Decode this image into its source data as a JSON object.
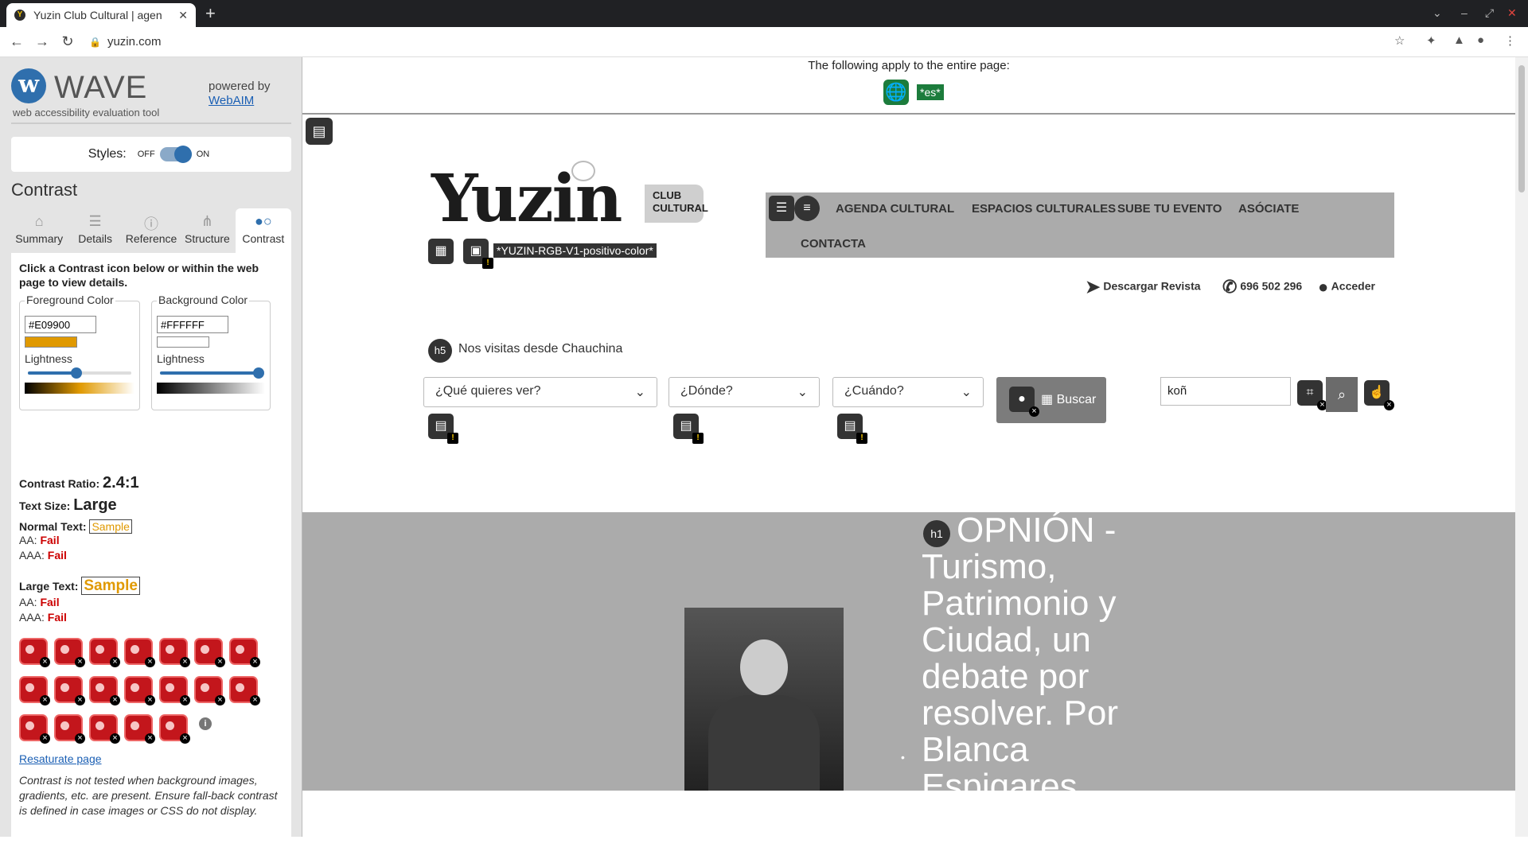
{
  "browser": {
    "tab_title": "Yuzin Club Cultural | agen",
    "url": "yuzin.com",
    "new_tab": "+"
  },
  "wave": {
    "title": "WAVE",
    "subtitle": "web accessibility evaluation tool",
    "powered_by": "powered by",
    "webaim": "WebAIM",
    "styles_label": "Styles:",
    "off": "OFF",
    "on": "ON",
    "section_title": "Contrast",
    "tabs": [
      {
        "label": "Summary"
      },
      {
        "label": "Details"
      },
      {
        "label": "Reference"
      },
      {
        "label": "Structure"
      },
      {
        "label": "Contrast"
      }
    ],
    "instructions": "Click a Contrast icon below or within the web page to view details.",
    "foreground": {
      "label": "Foreground Color",
      "hex": "#E09900",
      "lightness_label": "Lightness",
      "lightness": 0.47
    },
    "background": {
      "label": "Background Color",
      "hex": "#FFFFFF",
      "lightness_label": "Lightness",
      "lightness": 0.97
    },
    "contrast_ratio_label": "Contrast Ratio:",
    "contrast_ratio": "2.4:1",
    "text_size_label": "Text Size:",
    "text_size": "Large",
    "normal_text_label": "Normal Text:",
    "large_text_label": "Large Text:",
    "sample": "Sample",
    "aa_label": "AA:",
    "aaa_label": "AAA:",
    "fail": "Fail",
    "resaturate": "Resaturate page",
    "note": "Contrast is not tested when background images, gradients, etc. are present. Ensure fall-back contrast is defined in case images or CSS do not display."
  },
  "page": {
    "applies_text": "The following apply to the entire page:",
    "lang_tag": "*es*",
    "logo_text": "Yuzin",
    "club_text": "CLUB CULTURAL",
    "alt_text": "*YUZIN-RGB-V1-positivo-color*",
    "nav": [
      "AGENDA CULTURAL",
      "ESPACIOS CULTURALES",
      "SUBE TU EVENTO",
      "ASÓCIATE",
      "CONTACTA"
    ],
    "descargar": "Descargar Revista",
    "phone": "696 502 296",
    "acceder": "Acceder",
    "h5_badge": "h5",
    "visitas": "Nos visitas desde Chauchina",
    "select_que": "¿Qué quieres ver?",
    "select_donde": "¿Dónde?",
    "select_cuando": "¿Cuándo?",
    "buscar": "Buscar",
    "search_value": "koñ",
    "h1_badge": "h1",
    "hero_title": "OPNIÓN - Turismo, Patrimonio y Ciudad, un debate por resolver. Por Blanca Espigares"
  },
  "colors": {
    "foreground": "#E09900",
    "background": "#FFFFFF",
    "wave_blue": "#2f6fad",
    "fail_red": "#cc0000",
    "hero_gray": "#ababab"
  }
}
